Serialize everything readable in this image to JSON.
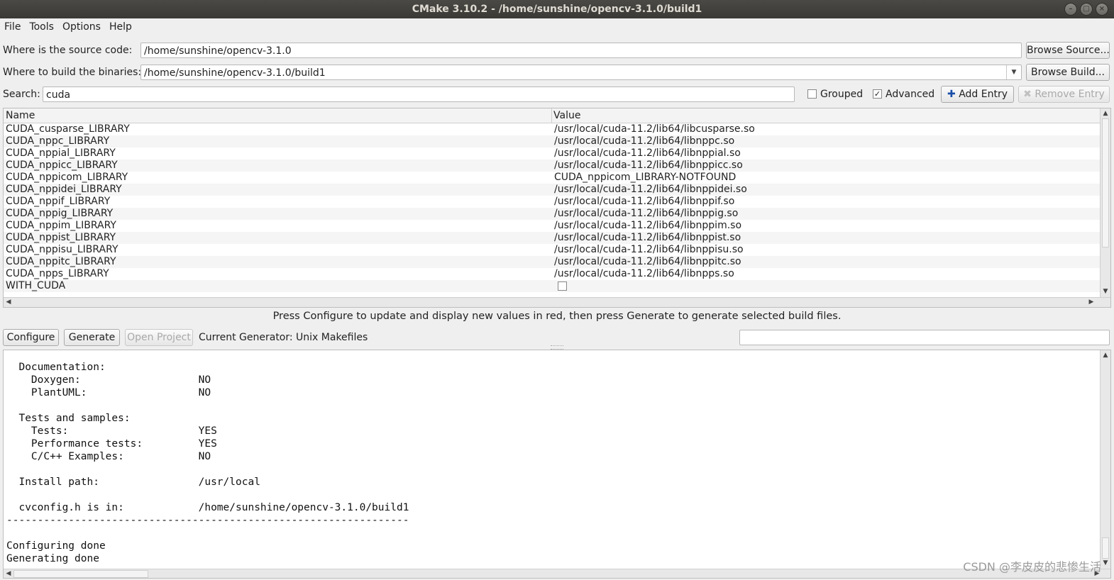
{
  "window": {
    "title": "CMake 3.10.2 - /home/sunshine/opencv-3.1.0/build1",
    "buttons": [
      "minimize-icon",
      "maximize-icon",
      "close-icon"
    ]
  },
  "menu": [
    "File",
    "Tools",
    "Options",
    "Help"
  ],
  "source": {
    "label": "Where is the source code:",
    "value": "/home/sunshine/opencv-3.1.0",
    "button": "Browse Source..."
  },
  "build": {
    "label": "Where to build the binaries:",
    "value": "/home/sunshine/opencv-3.1.0/build1",
    "button": "Browse Build..."
  },
  "search": {
    "label": "Search:",
    "value": "cuda"
  },
  "options": {
    "grouped": {
      "label": "Grouped",
      "checked": false
    },
    "advanced": {
      "label": "Advanced",
      "checked": true
    },
    "add_entry": "Add Entry",
    "remove_entry": "Remove Entry"
  },
  "table": {
    "headers": {
      "name": "Name",
      "value": "Value"
    },
    "rows": [
      {
        "name": "CUDA_cusparse_LIBRARY",
        "value": "/usr/local/cuda-11.2/lib64/libcusparse.so"
      },
      {
        "name": "CUDA_nppc_LIBRARY",
        "value": "/usr/local/cuda-11.2/lib64/libnppc.so"
      },
      {
        "name": "CUDA_nppial_LIBRARY",
        "value": "/usr/local/cuda-11.2/lib64/libnppial.so"
      },
      {
        "name": "CUDA_nppicc_LIBRARY",
        "value": "/usr/local/cuda-11.2/lib64/libnppicc.so"
      },
      {
        "name": "CUDA_nppicom_LIBRARY",
        "value": "CUDA_nppicom_LIBRARY-NOTFOUND"
      },
      {
        "name": "CUDA_nppidei_LIBRARY",
        "value": "/usr/local/cuda-11.2/lib64/libnppidei.so"
      },
      {
        "name": "CUDA_nppif_LIBRARY",
        "value": "/usr/local/cuda-11.2/lib64/libnppif.so"
      },
      {
        "name": "CUDA_nppig_LIBRARY",
        "value": "/usr/local/cuda-11.2/lib64/libnppig.so"
      },
      {
        "name": "CUDA_nppim_LIBRARY",
        "value": "/usr/local/cuda-11.2/lib64/libnppim.so"
      },
      {
        "name": "CUDA_nppist_LIBRARY",
        "value": "/usr/local/cuda-11.2/lib64/libnppist.so"
      },
      {
        "name": "CUDA_nppisu_LIBRARY",
        "value": "/usr/local/cuda-11.2/lib64/libnppisu.so"
      },
      {
        "name": "CUDA_nppitc_LIBRARY",
        "value": "/usr/local/cuda-11.2/lib64/libnppitc.so"
      },
      {
        "name": "CUDA_npps_LIBRARY",
        "value": "/usr/local/cuda-11.2/lib64/libnpps.so"
      },
      {
        "name": "WITH_CUDA",
        "value": "",
        "checkbox": true,
        "checked": false
      }
    ]
  },
  "hint": "Press Configure to update and display new values in red, then press Generate to generate selected build files.",
  "actions": {
    "configure": "Configure",
    "generate": "Generate",
    "open_project": "Open Project",
    "generator": "Current Generator: Unix Makefiles"
  },
  "output_log": "  Documentation:\n    Doxygen:                   NO\n    PlantUML:                  NO\n\n  Tests and samples:\n    Tests:                     YES\n    Performance tests:         YES\n    C/C++ Examples:            NO\n\n  Install path:                /usr/local\n\n  cvconfig.h is in:            /home/sunshine/opencv-3.1.0/build1\n-----------------------------------------------------------------\n\nConfiguring done\nGenerating done",
  "watermark": "CSDN @李皮皮的悲惨生活"
}
